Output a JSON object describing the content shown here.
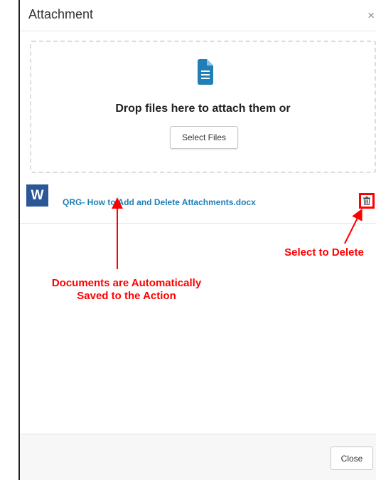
{
  "dialog": {
    "title": "Attachment",
    "close_icon": "×"
  },
  "dropzone": {
    "icon": "document-icon",
    "text": "Drop files here to attach them or",
    "select_files_label": "Select Files"
  },
  "attachments": [
    {
      "icon": "word-icon",
      "icon_letter": "W",
      "filename": "QRG- How to Add and Delete Attachments.docx",
      "delete_icon": "trash-icon"
    }
  ],
  "annotations": {
    "delete_note": "Select to Delete",
    "saved_note_line1": "Documents are Automatically",
    "saved_note_line2": "Saved to the Action"
  },
  "footer": {
    "close_label": "Close"
  },
  "colors": {
    "link": "#1f7fb6",
    "accent": "#1f7fb6",
    "annotation": "#ff0000",
    "word_blue": "#2b5797"
  }
}
